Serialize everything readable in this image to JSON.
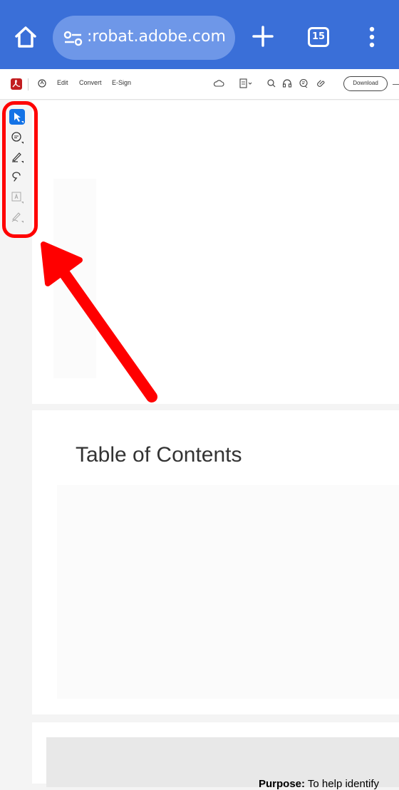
{
  "browser": {
    "url_text": ":robat.adobe.com",
    "tab_count": "15",
    "bar_color": "#3a6fd8"
  },
  "acrobat_toolbar": {
    "menu_items": [
      "Edit",
      "Convert",
      "E-Sign"
    ],
    "download_label": "Download",
    "icons": [
      "acrobat-logo-icon",
      "ai-assistant-icon",
      "cloud-icon",
      "page-view-icon",
      "search-icon",
      "read-aloud-icon",
      "comment-icon",
      "link-icon"
    ]
  },
  "tool_rail": {
    "tools": [
      "select-tool-icon",
      "comment-tool-icon",
      "draw-tool-icon",
      "lasso-tool-icon",
      "text-box-tool-icon",
      "sign-tool-icon"
    ],
    "selected_tool": "select-tool-icon",
    "accent_color": "#1473e6"
  },
  "document": {
    "toc_title": "Table of Contents",
    "purpose_label": "Purpose:",
    "purpose_text": "To help identify"
  },
  "annotation": {
    "color": "#ff0000"
  }
}
